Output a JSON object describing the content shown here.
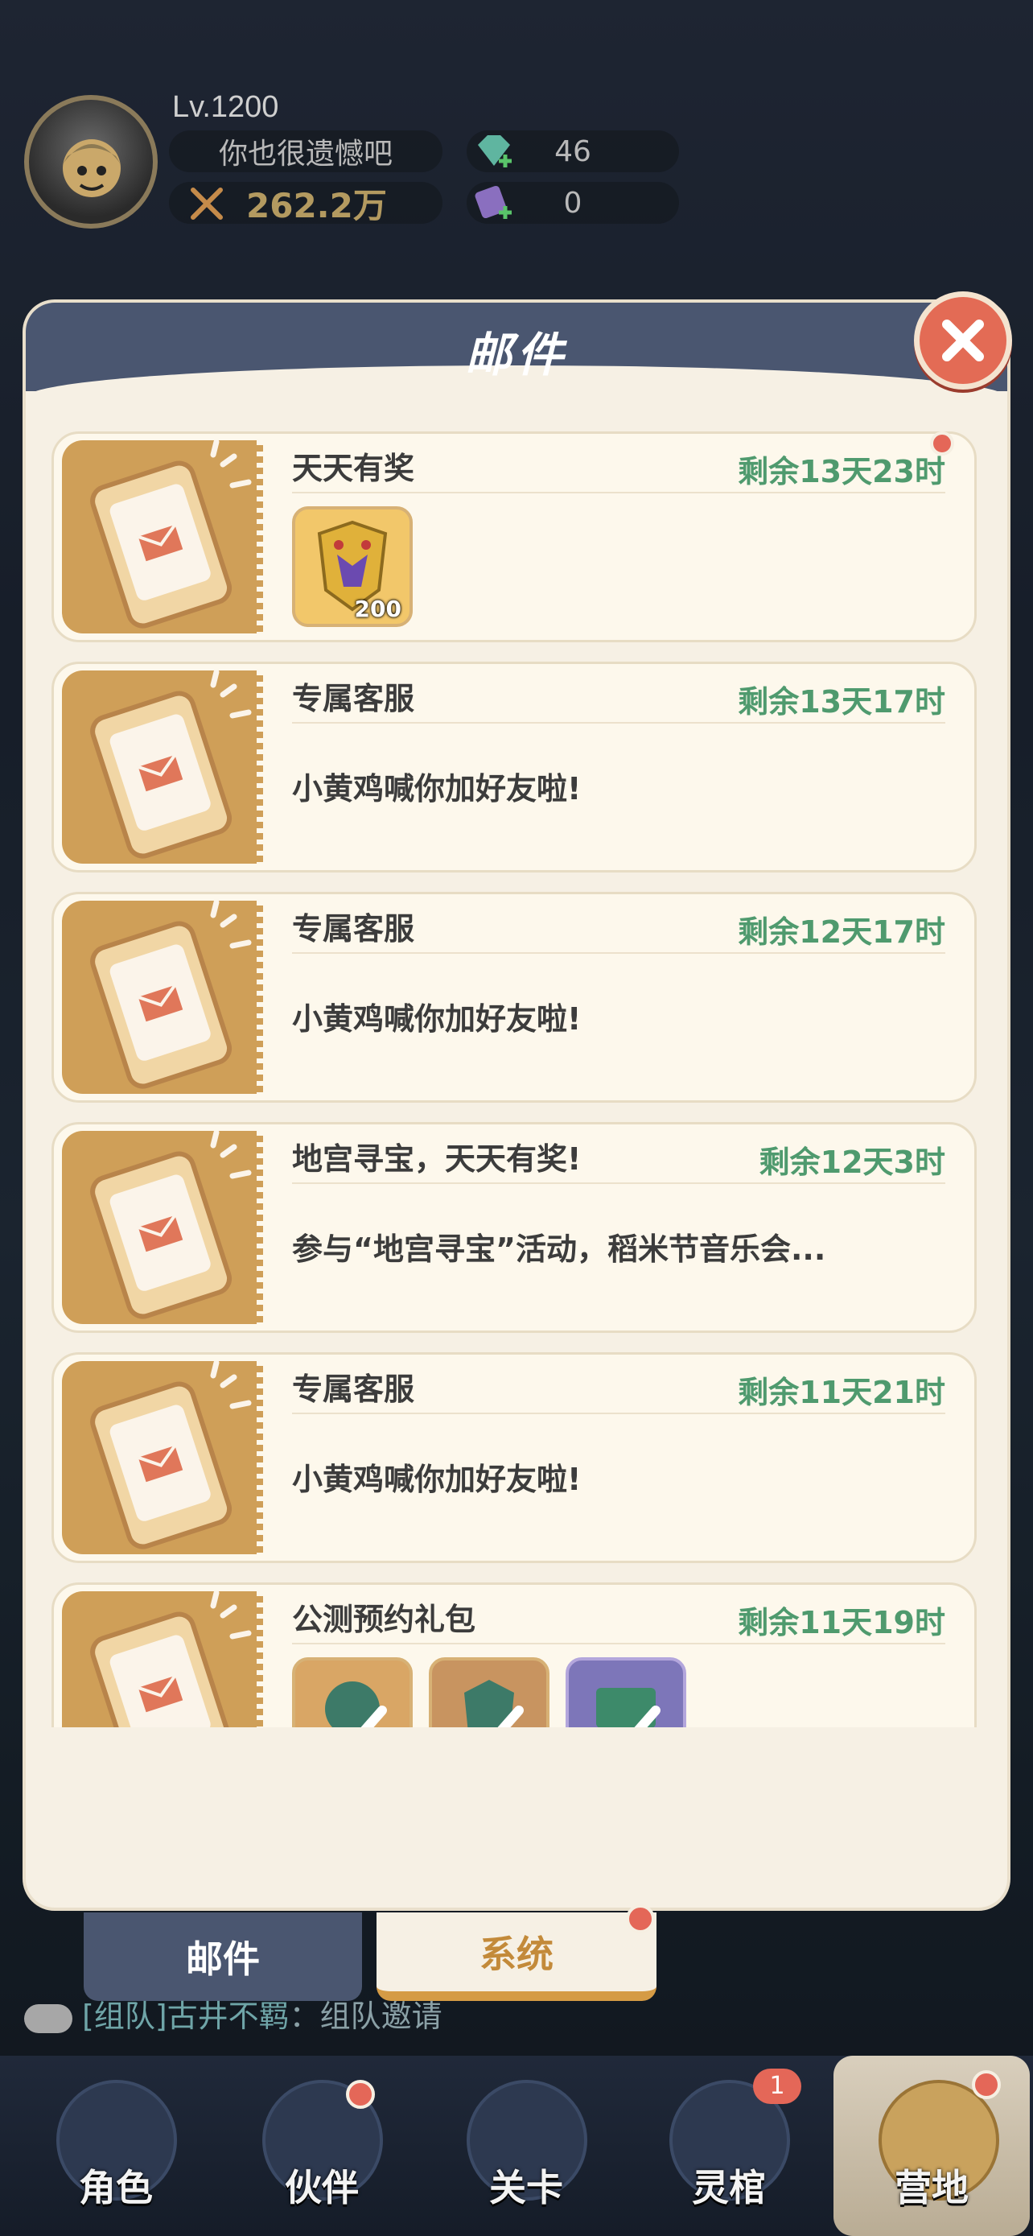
{
  "hud": {
    "level": "Lv.1200",
    "player_name": "你也很遗憾吧",
    "power": "262.2万",
    "gems": "46",
    "tickets": "0"
  },
  "dialog": {
    "title": "邮件"
  },
  "mails": [
    {
      "title": "天天有奖",
      "time": "剩余13天23时",
      "body": "",
      "rewards": [
        "200"
      ],
      "unread": true
    },
    {
      "title": "专属客服",
      "time": "剩余13天17时",
      "body": "小黄鸡喊你加好友啦!"
    },
    {
      "title": "专属客服",
      "time": "剩余12天17时",
      "body": "小黄鸡喊你加好友啦!"
    },
    {
      "title": "地宫寻宝，天天有奖!",
      "time": "剩余12天3时",
      "body": "参与“地宫寻宝”活动，稻米节音乐会..."
    },
    {
      "title": "专属客服",
      "time": "剩余11天21时",
      "body": "小黄鸡喊你加好友啦!"
    },
    {
      "title": "公测预约礼包",
      "time": "剩余11天19时",
      "body": ""
    }
  ],
  "tabs": {
    "mail": "邮件",
    "system": "系统"
  },
  "chat": {
    "channel": "[组队]",
    "sender": "古井不羁",
    "message": "：组队邀请"
  },
  "nav": [
    {
      "label": "角色"
    },
    {
      "label": "伙伴"
    },
    {
      "label": "关卡"
    },
    {
      "label": "灵棺",
      "badge": "1"
    },
    {
      "label": "营地"
    }
  ],
  "colors": {
    "accent_blue": "#4a5670",
    "time_green": "#4f9a6e",
    "badge_red": "#e46758",
    "panel_bg": "#f6f0e4"
  }
}
